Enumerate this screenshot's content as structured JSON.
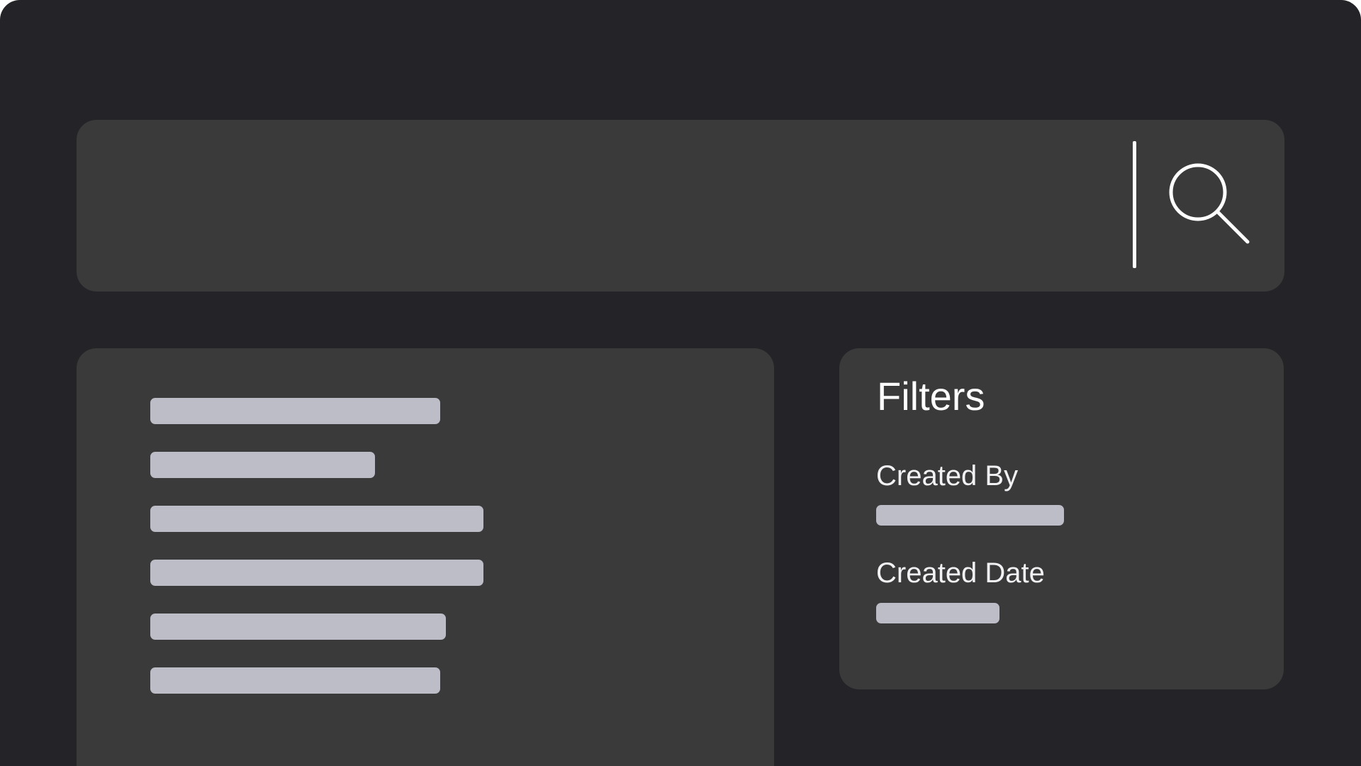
{
  "search": {
    "value": "",
    "placeholder": "",
    "icon": "search-icon"
  },
  "results": {
    "count": 6,
    "items": [
      "",
      "",
      "",
      "",
      "",
      ""
    ]
  },
  "filters": {
    "title": "Filters",
    "created_by": {
      "label": "Created By",
      "value": ""
    },
    "created_date": {
      "label": "Created Date",
      "value": ""
    }
  },
  "colors": {
    "background": "#232328",
    "panel": "#3a3a3a",
    "placeholder_bar": "#bdbdc8",
    "text": "#ffffff"
  }
}
